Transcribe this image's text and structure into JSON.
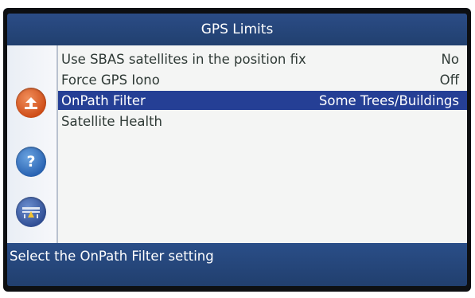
{
  "window": {
    "title": "GPS Limits"
  },
  "menu": {
    "items": [
      {
        "label": "Use SBAS satellites in the position fix",
        "value": "No",
        "selected": false
      },
      {
        "label": "Force GPS Iono",
        "value": "Off",
        "selected": false
      },
      {
        "label": "OnPath Filter",
        "value": "Some Trees/Buildings",
        "selected": true
      },
      {
        "label": "Satellite Health",
        "value": "",
        "selected": false
      }
    ]
  },
  "sidebar": {
    "icons": [
      "back-arrow-icon",
      "help-icon",
      "implement-icon"
    ],
    "help_glyph": "?"
  },
  "status": {
    "text": "Select the OnPath Filter setting"
  },
  "colors": {
    "titlebar": "#21406f",
    "selected_row": "#253f95",
    "back_button": "#cf4e19",
    "help_button": "#2a64b3"
  }
}
